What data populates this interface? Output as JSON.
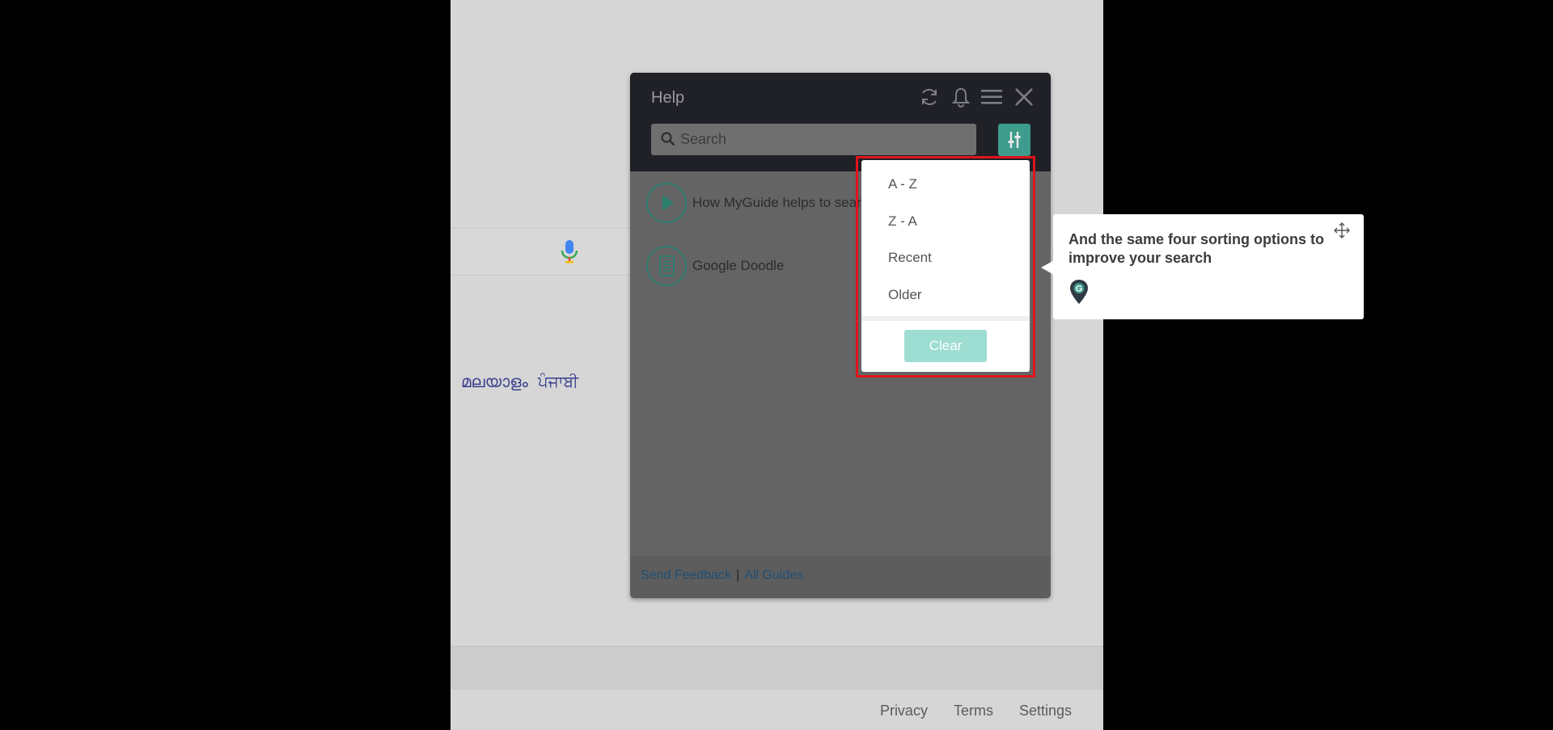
{
  "browser": {
    "languages": [
      "മലയാളം",
      "ਪੰਜਾਬੀ"
    ],
    "footer_links": [
      "Privacy",
      "Terms",
      "Settings"
    ]
  },
  "panel": {
    "title": "Help",
    "header_icons": [
      "refresh-icon",
      "bell-icon",
      "menu-icon",
      "close-icon"
    ],
    "search": {
      "placeholder": "Search",
      "value": ""
    },
    "filter_icon": "sliders-icon",
    "items": [
      {
        "label": "How MyGuide helps to sear",
        "icon": "play-icon"
      },
      {
        "label": "Google Doodle",
        "icon": "document-icon"
      }
    ],
    "footer": {
      "send_feedback": "Send Feedback",
      "separator": "|",
      "all_guides": "All Guides"
    }
  },
  "sort_menu": {
    "options": [
      "A - Z",
      "Z - A",
      "Recent",
      "Older"
    ],
    "clear_label": "Clear"
  },
  "tooltip": {
    "text": "And the same four sorting options to improve your search",
    "logo_icon": "map-pin-logo-icon",
    "move_icon": "move-icon"
  },
  "colors": {
    "panel_header": "#202027",
    "accent": "#3e9c8c",
    "clear_button": "#9dddd2",
    "highlight": "#e0141b",
    "link": "#1f4f76"
  }
}
